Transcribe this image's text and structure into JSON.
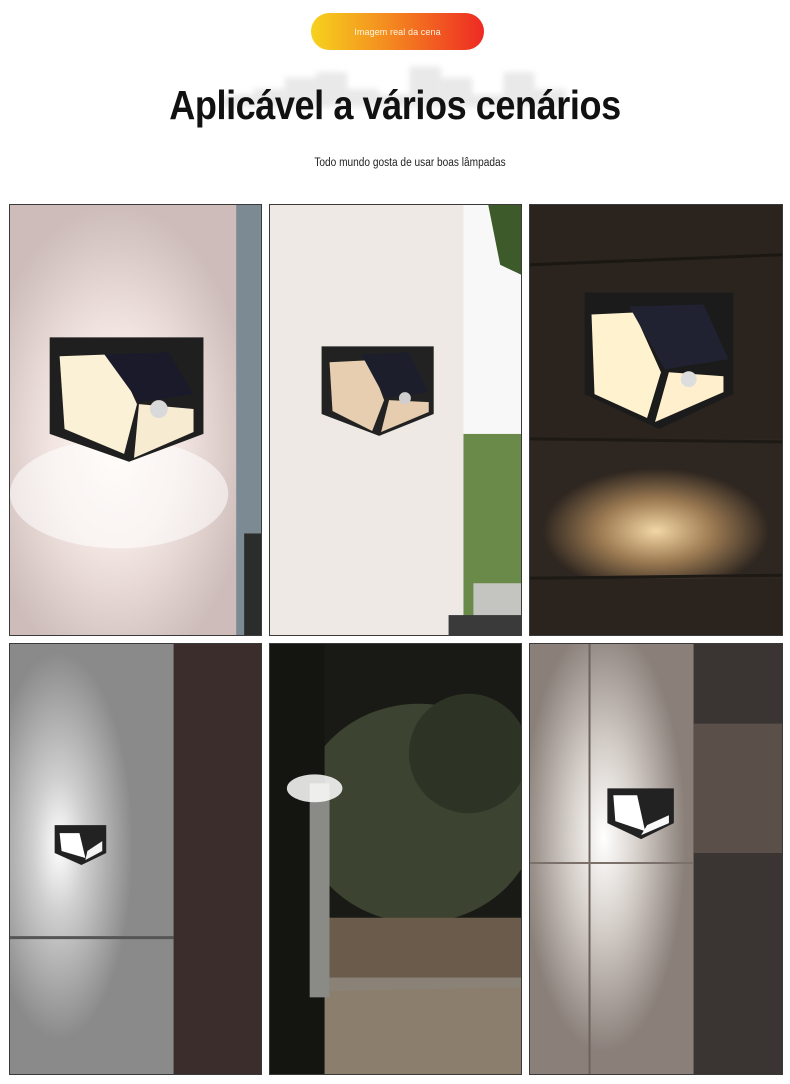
{
  "badge": {
    "label": "Imagem real da cena"
  },
  "header": {
    "title": "Aplicável a vários cenários",
    "subtitle": "Todo mundo gosta de usar boas lâmpadas"
  },
  "colors": {
    "badge_start": "#f6d21e",
    "badge_end": "#ee2a24",
    "frame": "#3a3a3a",
    "warm_light": "#ffe7b0",
    "cool_light": "#ffffff"
  },
  "gallery": [
    {
      "scene": "white-light-lamp-on-pink-wall"
    },
    {
      "scene": "lamp-on-white-wall-daylight"
    },
    {
      "scene": "warm-light-lamp-on-wood-wall"
    },
    {
      "scene": "lamp-on-grey-wall-at-night"
    },
    {
      "scene": "garden-post-light-at-night"
    },
    {
      "scene": "lamp-on-tiled-wall-at-night"
    }
  ]
}
